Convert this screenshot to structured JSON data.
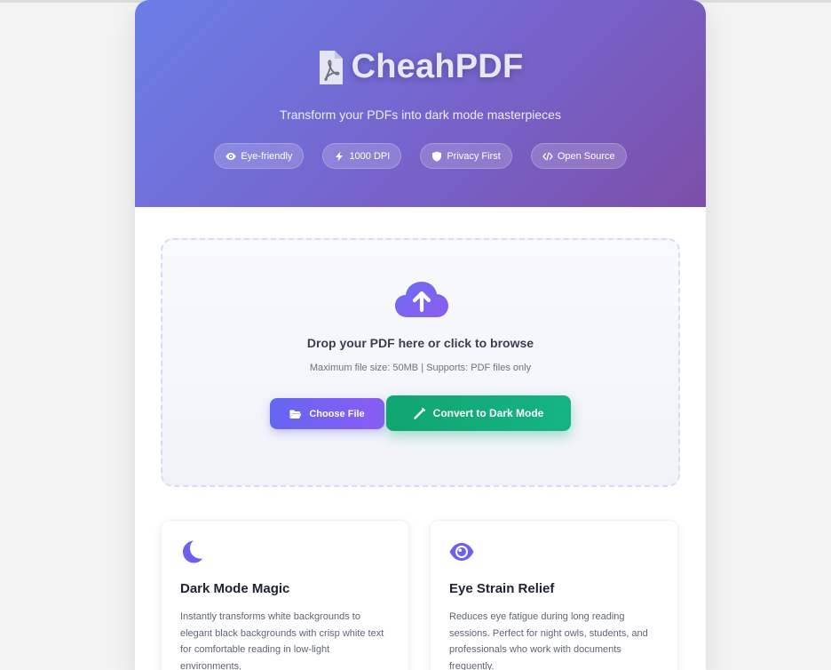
{
  "app": {
    "title": "CheahPDF",
    "tagline": "Transform your PDFs into dark mode masterpieces",
    "brand_icon": "pdf-file-icon"
  },
  "badges": [
    {
      "label": "Eye-friendly",
      "icon": "eye-icon"
    },
    {
      "label": "1000 DPI",
      "icon": "bolt-icon"
    },
    {
      "label": "Privacy First",
      "icon": "shield-icon"
    },
    {
      "label": "Open Source",
      "icon": "code-icon"
    }
  ],
  "upload": {
    "icon": "cloud-upload-icon",
    "title": "Drop your PDF here or click to browse",
    "subtitle": "Maximum file size: 50MB | Supports: PDF files only",
    "choose_label": "Choose File",
    "convert_label": "Convert to Dark Mode"
  },
  "features": [
    {
      "icon": "moon-icon",
      "title": "Dark Mode Magic",
      "description": "Instantly transforms white backgrounds to elegant black backgrounds with crisp white text for comfortable reading in low-light environments."
    },
    {
      "icon": "eye-icon",
      "title": "Eye Strain Relief",
      "description": "Reduces eye fatigue during long reading sessions. Perfect for night owls, students, and professionals who work with documents frequently."
    }
  ],
  "colors": {
    "hero_start": "#6a7ee6",
    "hero_end": "#7c4fa8",
    "accent_purple": "#6466f1",
    "accent_green": "#10a572"
  }
}
